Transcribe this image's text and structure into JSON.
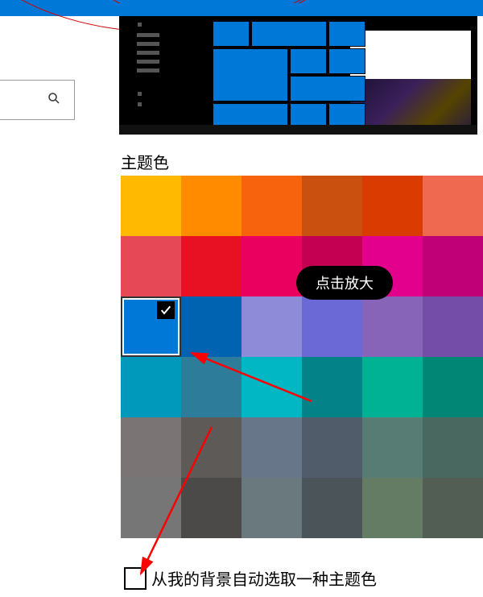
{
  "section_title": "主题色",
  "tooltip": "点击放大",
  "checkbox_label": "从我的背景自动选取一种主题色",
  "selected_color_index": 12,
  "palette": [
    "#ffb900",
    "#ff8c00",
    "#f7630c",
    "#ca5010",
    "#da3b01",
    "#ef6950",
    "#e74856",
    "#e81123",
    "#ea005e",
    "#c30052",
    "#e3008c",
    "#bf0077",
    "#0078d7",
    "#0063b1",
    "#8e8cd8",
    "#6b69d6",
    "#8764b8",
    "#744da9",
    "#0099bc",
    "#2d7d9a",
    "#00b7c3",
    "#038387",
    "#00b294",
    "#018574",
    "#7a7574",
    "#5d5a58",
    "#68768a",
    "#515c6b",
    "#567c73",
    "#486860",
    "#767676",
    "#4c4a48",
    "#69797e",
    "#4a5459",
    "#647c64",
    "#525e54"
  ]
}
